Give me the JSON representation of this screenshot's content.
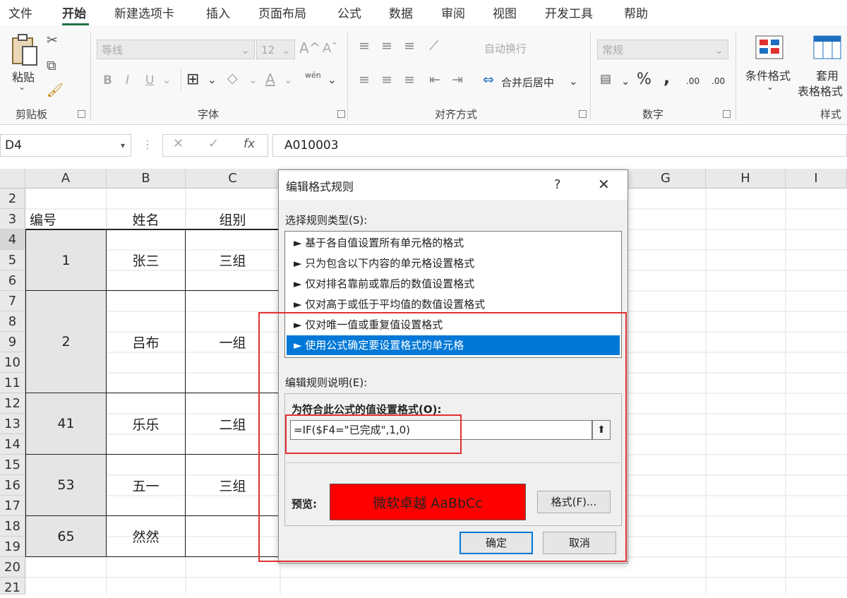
{
  "tabs": [
    "文件",
    "开始",
    "新建选项卡",
    "插入",
    "页面布局",
    "公式",
    "数据",
    "审阅",
    "视图",
    "开发工具",
    "帮助"
  ],
  "active_tab": "开始",
  "ribbon": {
    "clipboard": {
      "paste_label": "粘贴",
      "group_label": "剪贴板"
    },
    "font": {
      "font_name": "等线",
      "font_size": "12",
      "bold": "B",
      "italic": "I",
      "underline": "U",
      "group_label": "字体",
      "phonetic": "wén"
    },
    "alignment": {
      "wrap_text": "自动换行",
      "merge_center": "合并后居中",
      "group_label": "对齐方式"
    },
    "number": {
      "format": "常规",
      "percent": "%",
      "comma": ",",
      "inc_decimal": ".00",
      "dec_decimal": ".00",
      "group_label": "数字"
    },
    "styles": {
      "conditional_format": "条件格式",
      "table_format_1": "套用",
      "table_format_2": "表格格式",
      "group_label": "样式"
    }
  },
  "formula_bar": {
    "name_box": "D4",
    "fx": "fx",
    "formula": "A010003"
  },
  "columns": [
    "A",
    "B",
    "C",
    "G",
    "H",
    "I"
  ],
  "rows": [
    "2",
    "3",
    "4",
    "5",
    "6",
    "7",
    "8",
    "9",
    "10",
    "11",
    "12",
    "13",
    "14",
    "15",
    "16",
    "17",
    "18",
    "19",
    "20",
    "21"
  ],
  "table": {
    "headers": [
      "编号",
      "姓名",
      "组别"
    ],
    "records": [
      {
        "id": "1",
        "name": "张三",
        "group": "三组"
      },
      {
        "id": "2",
        "name": "吕布",
        "group": "一组"
      },
      {
        "id": "41",
        "name": "乐乐",
        "group": "二组"
      },
      {
        "id": "53",
        "name": "五一",
        "group": "三组"
      },
      {
        "id": "65",
        "name": "然然",
        "group": ""
      }
    ]
  },
  "dialog": {
    "title": "编辑格式规则",
    "help": "?",
    "close": "✕",
    "select_type_label": "选择规则类型(S):",
    "rule_types": [
      "► 基于各自值设置所有单元格的格式",
      "► 只为包含以下内容的单元格设置格式",
      "► 仅对排名靠前或靠后的数值设置格式",
      "► 仅对高于或低于平均值的数值设置格式",
      "► 仅对唯一值或重复值设置格式",
      "► 使用公式确定要设置格式的单元格"
    ],
    "selected_rule_index": 5,
    "edit_desc_label": "编辑规则说明(E):",
    "formula_section_label": "为符合此公式的值设置格式(O):",
    "formula_value": "=IF($F4=\"已完成\",1,0)",
    "preview_label": "预览:",
    "preview_text": "微软卓越  AaBbCc",
    "preview_color": "#ff0000",
    "format_button": "格式(F)...",
    "ok_button": "确定",
    "cancel_button": "取消"
  },
  "highlight_color": "#e03131"
}
